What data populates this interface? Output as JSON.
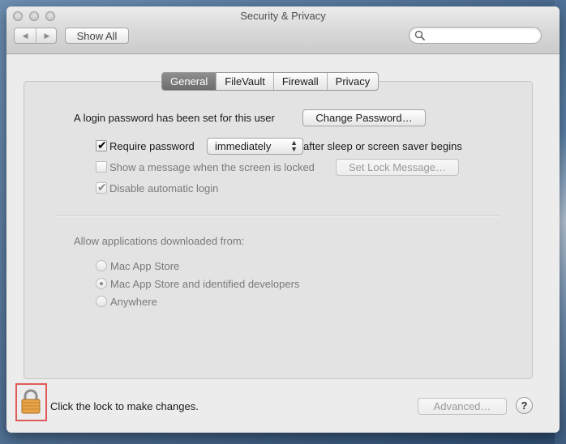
{
  "window": {
    "title": "Security & Privacy"
  },
  "toolbar": {
    "back_icon": "chevron-left-icon",
    "forward_icon": "chevron-right-icon",
    "show_all_label": "Show All",
    "search_placeholder": ""
  },
  "tabs": [
    {
      "label": "General",
      "active": true
    },
    {
      "label": "FileVault",
      "active": false
    },
    {
      "label": "Firewall",
      "active": false
    },
    {
      "label": "Privacy",
      "active": false
    }
  ],
  "general": {
    "login_password_text": "A login password has been set for this user",
    "change_password_label": "Change Password…",
    "require_password": {
      "label": "Require password",
      "checked": true
    },
    "require_password_delay": "immediately",
    "after_sleep_text": "after sleep or screen saver begins",
    "show_message": {
      "label": "Show a message when the screen is locked",
      "checked": false
    },
    "set_lock_message_label": "Set Lock Message…",
    "disable_auto_login": {
      "label": "Disable automatic login",
      "checked": true
    },
    "allow_apps_heading": "Allow applications downloaded from:",
    "allow_options": [
      {
        "label": "Mac App Store",
        "selected": false
      },
      {
        "label": "Mac App Store and identified developers",
        "selected": true
      },
      {
        "label": "Anywhere",
        "selected": false
      }
    ]
  },
  "footer": {
    "lock_text": "Click the lock to make changes.",
    "advanced_label": "Advanced…",
    "help_label": "?"
  },
  "colors": {
    "lock_highlight": "#e15a5a",
    "active_tab": "#7a7a7a"
  }
}
